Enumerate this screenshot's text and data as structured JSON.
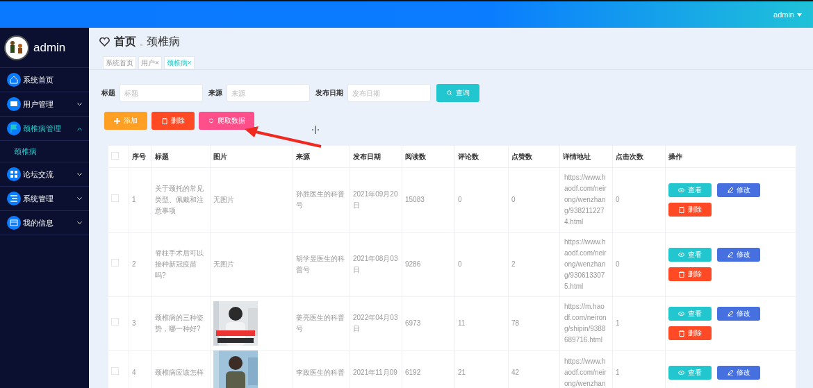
{
  "topbar": {
    "user": "admin"
  },
  "sidebar": {
    "user": "admin",
    "items": [
      {
        "label": "系统首页",
        "expandable": false,
        "selected": false
      },
      {
        "label": "用户管理",
        "expandable": true,
        "expanded": false,
        "selected": false
      },
      {
        "label": "颈椎病管理",
        "expandable": true,
        "expanded": true,
        "selected": true,
        "children": [
          {
            "label": "颈椎病",
            "selected": true
          }
        ]
      },
      {
        "label": "论坛交流",
        "expandable": true,
        "expanded": false,
        "selected": false
      },
      {
        "label": "系统管理",
        "expandable": true,
        "expanded": false,
        "selected": false
      },
      {
        "label": "我的信息",
        "expandable": true,
        "expanded": false,
        "selected": false
      }
    ]
  },
  "breadcrumb": [
    "首页",
    "颈椎病"
  ],
  "tabs": [
    {
      "label": "系统首页",
      "selected": false
    },
    {
      "label": "用户",
      "close": "×",
      "selected": false
    },
    {
      "label": "颈椎病",
      "close": "×",
      "selected": true
    }
  ],
  "search": {
    "fields": [
      {
        "label": "标题",
        "placeholder": "标题"
      },
      {
        "label": "来源",
        "placeholder": "来源"
      },
      {
        "label": "发布日期",
        "placeholder": "发布日期"
      }
    ],
    "button": "查询"
  },
  "toolbar": [
    {
      "label": "添加",
      "kind": "add"
    },
    {
      "label": "删除",
      "kind": "delete"
    },
    {
      "label": "爬取数据",
      "kind": "crawl"
    }
  ],
  "table": {
    "header_checked": false,
    "columns": [
      "序号",
      "标题",
      "图片",
      "来源",
      "发布日期",
      "阅读数",
      "评论数",
      "点赞数",
      "详情地址",
      "点击次数",
      "操作"
    ],
    "rows": [
      {
        "checked": false,
        "no": "1",
        "title": "关于颈托的常见类型、佩戴和注意事项",
        "image": {
          "kind": "text",
          "text": "无图片"
        },
        "source": "孙胜医生的科普号",
        "date": "2021年09月20日",
        "reads": "15083",
        "comments": "0",
        "likes": "0",
        "url": "https://www.haodf.com/neirong/wenzhang/9382112274.html",
        "clicks": "0",
        "actions": [
          {
            "label": "查看",
            "kind": "view"
          },
          {
            "label": "修改",
            "kind": "edit"
          },
          {
            "label": "删除",
            "kind": "delete"
          }
        ]
      },
      {
        "checked": false,
        "no": "2",
        "title": "脊柱手术后可以接种新冠疫苗吗?",
        "image": {
          "kind": "text",
          "text": "无图片"
        },
        "source": "胡学昱医生的科普号",
        "date": "2021年08月03日",
        "reads": "9286",
        "comments": "0",
        "likes": "2",
        "url": "https://www.haodf.com/neirong/wenzhang/9306133075.html",
        "clicks": "0",
        "actions": [
          {
            "label": "查看",
            "kind": "view"
          },
          {
            "label": "修改",
            "kind": "edit"
          },
          {
            "label": "删除",
            "kind": "delete"
          }
        ]
      },
      {
        "checked": false,
        "no": "3",
        "title": "颈椎病的三种姿势，哪一种好?",
        "image": {
          "kind": "picture"
        },
        "source": "姜亮医生的科普号",
        "date": "2022年04月03日",
        "reads": "6973",
        "comments": "11",
        "likes": "78",
        "url": "https://m.haodf.com/neirong/shipin/9388689716.html",
        "clicks": "1",
        "actions": [
          {
            "label": "查看",
            "kind": "view"
          },
          {
            "label": "修改",
            "kind": "edit"
          },
          {
            "label": "删除",
            "kind": "delete"
          }
        ]
      },
      {
        "checked": false,
        "no": "4",
        "title": "颈椎病应该怎样",
        "image": {
          "kind": "picture"
        },
        "source": "李政医生的科普",
        "date": "2021年11月09",
        "reads": "6192",
        "comments": "21",
        "likes": "42",
        "url": "https://www.haodf.com/neirong/wenzhan",
        "clicks": "1",
        "actions": [
          {
            "label": "查看",
            "kind": "view"
          },
          {
            "label": "修改",
            "kind": "edit"
          }
        ]
      }
    ]
  }
}
